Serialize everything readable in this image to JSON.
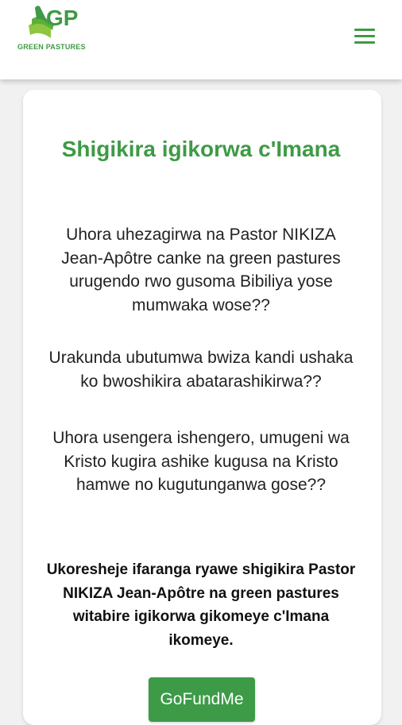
{
  "header": {
    "logo_text": "GREEN PASTURES",
    "menu_icon": "hamburger-icon"
  },
  "main": {
    "title": "Shigikira igikorwa c'Imana",
    "paragraphs": [
      "Uhora uhezagirwa na Pastor NIKIZA Jean-Apôtre canke na green pastures urugendo rwo gusoma Bibiliya yose mumwaka wose??",
      "Urakunda ubutumwa bwiza kandi ushaka ko bwoshikira abatarashikirwa??",
      "Uhora usengera ishengero, umugeni wa Kristo kugira ashike kugusa na Kristo hamwe no kugutunganwa gose??"
    ],
    "call_to_action": "Ukoresheje ifaranga ryawe shigikira Pastor NIKIZA Jean-Apôtre na green pastures witabire igikorwa gikomeye c'Imana ikomeye.",
    "button_label": "GoFundMe"
  },
  "colors": {
    "brand_green": "#3e9a45",
    "page_background": "#f1f1f1",
    "card_background": "#ffffff"
  }
}
